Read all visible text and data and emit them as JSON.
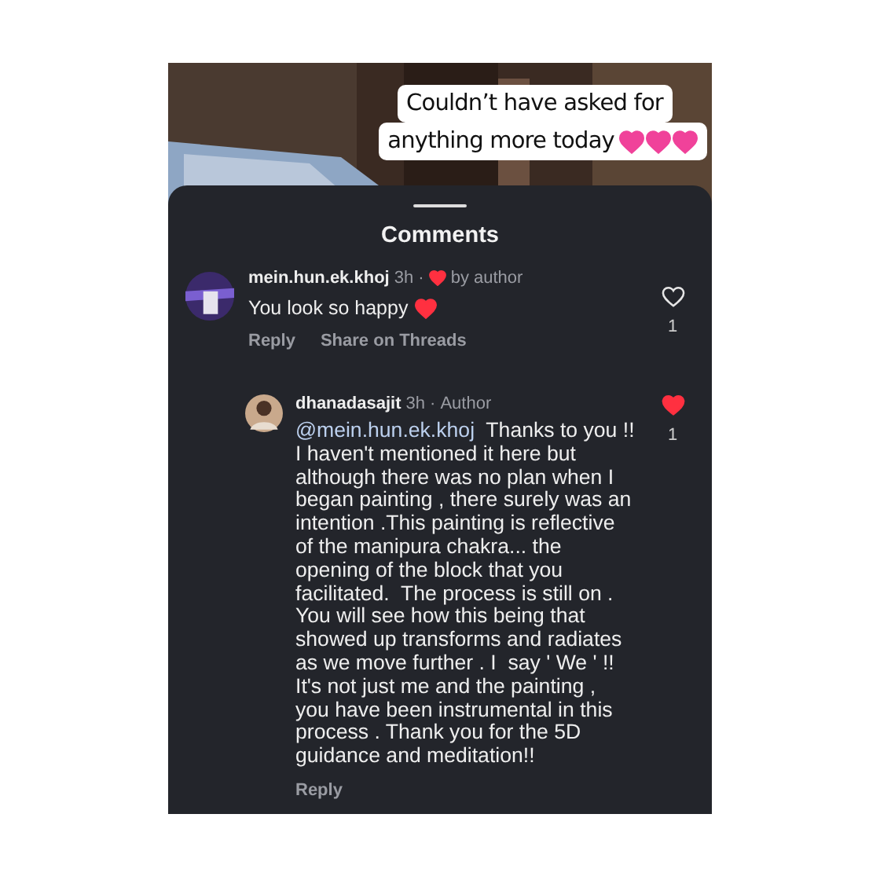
{
  "story": {
    "caption_lines": [
      "Couldn’t have asked for",
      "anything more today"
    ]
  },
  "sheet": {
    "title": "Comments"
  },
  "comments": [
    {
      "username": "mein.hun.ek.khoj",
      "time": "3h ·",
      "liked_by_author": true,
      "author_label": "by author",
      "text": "You look so happy",
      "actions": [
        "Reply",
        "Share on Threads"
      ],
      "liked": false,
      "like_count": "1",
      "replies": [
        {
          "username": "dhanadasajit",
          "time": "3h ·",
          "badge": "Author",
          "mention": "@mein.hun.ek.khoj",
          "text": "  Thanks to you !! I haven't mentioned it here but although there was no plan when I began painting , there surely was an intention .This painting is reflective of the manipura chakra... the opening of the block that you facilitated.  The process is still on . You will see how this being that showed up transforms and radiates as we move further . I  say ' We ' !! It's not just me and the painting , you have been instrumental in this process . Thank you for the 5D guidance and meditation!!",
          "actions": [
            "Reply"
          ],
          "liked": true,
          "like_count": "1"
        }
      ]
    }
  ]
}
